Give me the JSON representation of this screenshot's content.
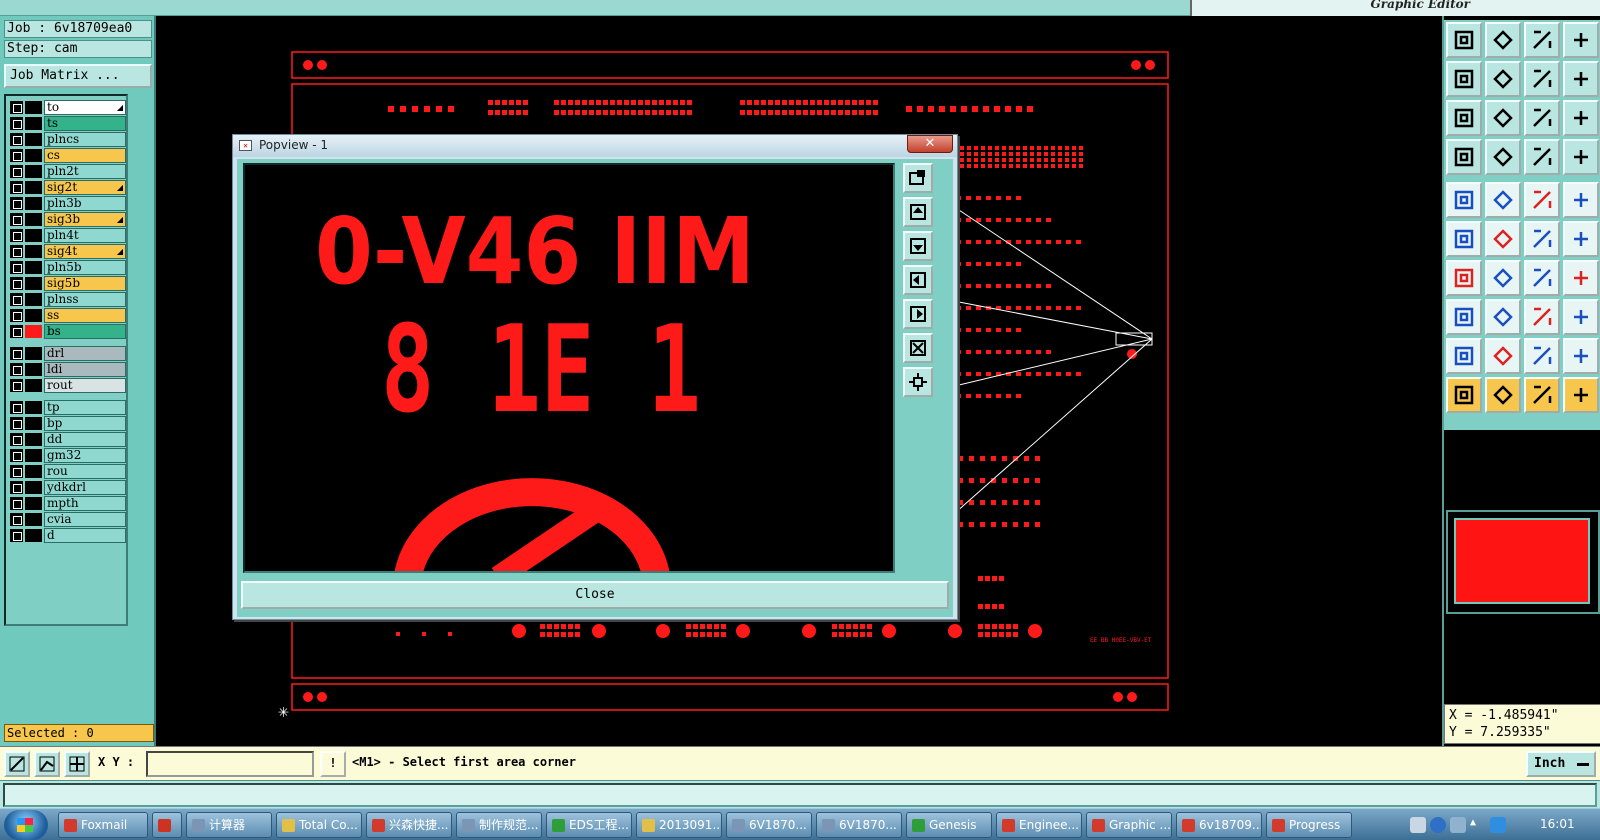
{
  "top_bar": {
    "right_title": "Graphic Editor"
  },
  "left_panel": {
    "job_line": "Job : 6v18709ea0",
    "step_line": "Step: cam",
    "job_matrix_label": "Job Matrix ...",
    "layers": [
      {
        "name": "to",
        "color": "#ffffff",
        "sel": true
      },
      {
        "name": "ts",
        "color": "#34b28a",
        "sel": false
      },
      {
        "name": "plncs",
        "color": "#8fd8d0",
        "sel": false
      },
      {
        "name": "cs",
        "color": "#f7c64c",
        "sel": false
      },
      {
        "name": "pln2t",
        "color": "#8fd8d0",
        "sel": false
      },
      {
        "name": "sig2t",
        "color": "#f7c64c",
        "sel": true
      },
      {
        "name": "pln3b",
        "color": "#8fd8d0",
        "sel": false
      },
      {
        "name": "sig3b",
        "color": "#f7c64c",
        "sel": true
      },
      {
        "name": "pln4t",
        "color": "#8fd8d0",
        "sel": false
      },
      {
        "name": "sig4t",
        "color": "#f7c64c",
        "sel": true
      },
      {
        "name": "pln5b",
        "color": "#8fd8d0",
        "sel": false
      },
      {
        "name": "sig5b",
        "color": "#f7c64c",
        "sel": false
      },
      {
        "name": "plnss",
        "color": "#8fd8d0",
        "sel": false
      },
      {
        "name": "ss",
        "color": "#f7c64c",
        "sel": false
      },
      {
        "name": "bs",
        "color": "#34b28a",
        "sel": false
      },
      {
        "name": "drl",
        "color": "#a9b9bd",
        "sel": false
      },
      {
        "name": "ldi",
        "color": "#a9b9bd",
        "sel": false
      },
      {
        "name": "rout",
        "color": "#d9e3e3",
        "sel": false
      },
      {
        "name": "tp",
        "color": "#8fd8d0",
        "sel": false
      },
      {
        "name": "bp",
        "color": "#8fd8d0",
        "sel": false
      },
      {
        "name": "dd",
        "color": "#8fd8d0",
        "sel": false
      },
      {
        "name": "gm32",
        "color": "#8fd8d0",
        "sel": false
      },
      {
        "name": "rou",
        "color": "#8fd8d0",
        "sel": false
      },
      {
        "name": "ydkdrl",
        "color": "#8fd8d0",
        "sel": false
      },
      {
        "name": "mpth",
        "color": "#8fd8d0",
        "sel": false
      },
      {
        "name": "cvia",
        "color": "#8fd8d0",
        "sel": false
      },
      {
        "name": "d",
        "color": "#8fd8d0",
        "sel": false
      }
    ],
    "selected_line": "Selected : 0"
  },
  "popview": {
    "title": "Popview - 1",
    "close_label": "Close",
    "marking_line1": "0-V46 IIM",
    "marking_line2": "8 1E 1",
    "marking_color": "#ff1a1a"
  },
  "board": {
    "trace_color": "#ff1a1a",
    "pad_color": "#ff1a1a",
    "line_color": "#ffffff",
    "micro_text": "EE BB H0EE-VBV-ET"
  },
  "right_panel": {
    "coord_x": "X = -1.485941\"",
    "coord_y": "Y = 7.259335\""
  },
  "command_bar": {
    "xy_label": "X Y :",
    "xy_value": "",
    "warn_label": "!",
    "prompt": "<M1> - Select first area corner",
    "unit_label": "Inch"
  },
  "taskbar": {
    "items": [
      {
        "label": "Foxmail",
        "color": "#d23b2b"
      },
      {
        "label": "",
        "color": "#cc3322"
      },
      {
        "label": "计算器",
        "color": "#7b95b4"
      },
      {
        "label": "Total Co...",
        "color": "#e1c04a"
      },
      {
        "label": "兴森快捷...",
        "color": "#d23b2b"
      },
      {
        "label": "制作规范...",
        "color": "#7b95b4"
      },
      {
        "label": "EDS工程...",
        "color": "#2f9d3a"
      },
      {
        "label": "2013091...",
        "color": "#e1c04a"
      },
      {
        "label": "6V1870...",
        "color": "#7b95b4"
      },
      {
        "label": "6V1870...",
        "color": "#7b95b4"
      },
      {
        "label": "Genesis",
        "color": "#2f9d3a"
      },
      {
        "label": "Enginee...",
        "color": "#d23b2b"
      },
      {
        "label": "Graphic ...",
        "color": "#d23b2b"
      },
      {
        "label": "6v18709...",
        "color": "#d23b2b"
      },
      {
        "label": "Progress",
        "color": "#d23b2b"
      }
    ],
    "clock": "16:01"
  }
}
